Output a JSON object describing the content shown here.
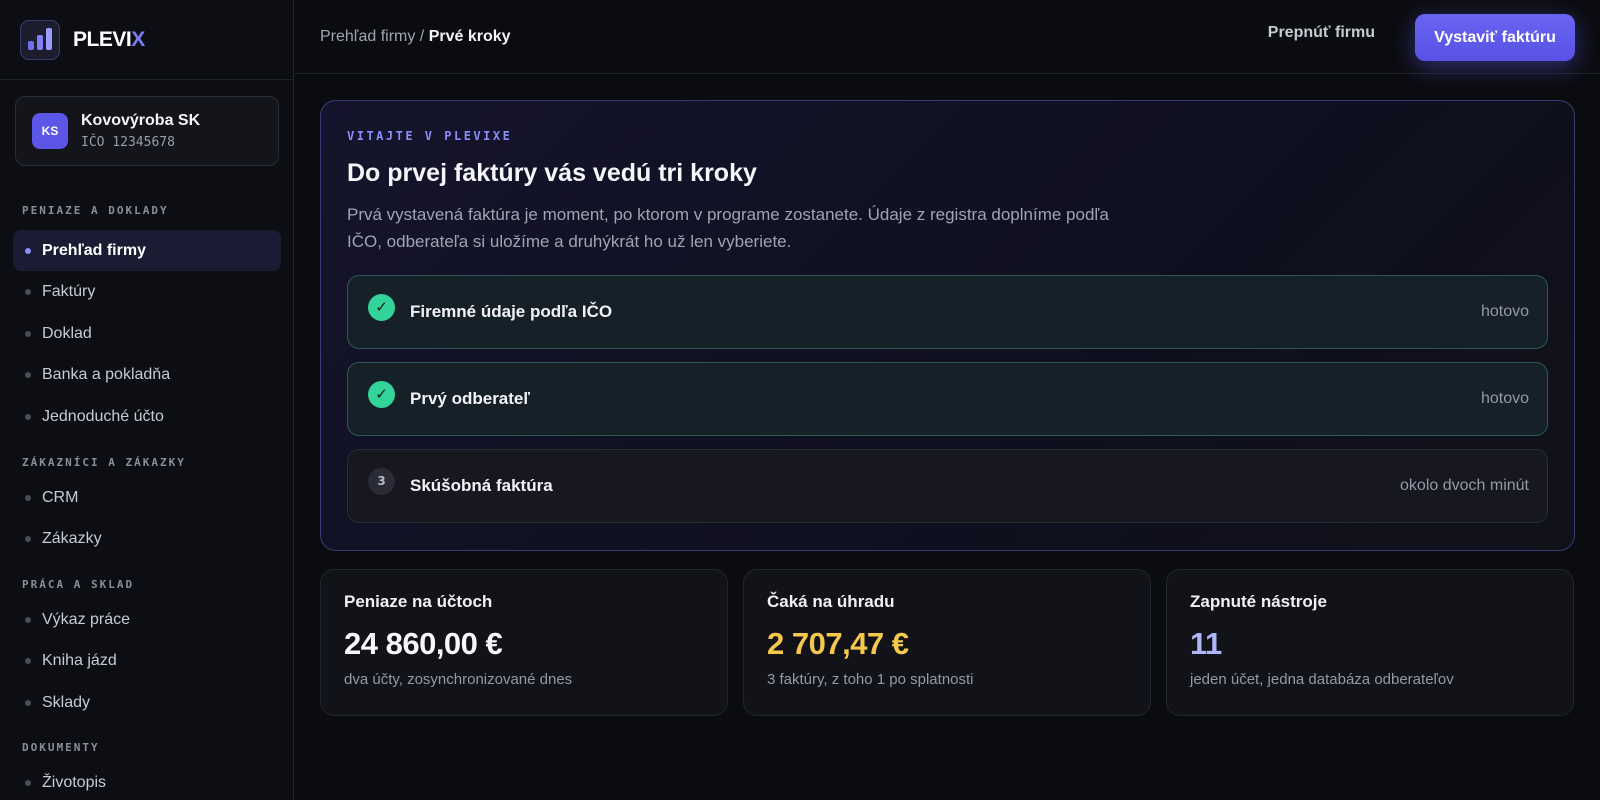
{
  "brand": {
    "name_main": "PLEVI",
    "name_accent": "X"
  },
  "company": {
    "initials": "KS",
    "name": "Kovovýroba SK",
    "ico": "IČO 12345678"
  },
  "sidebar": {
    "sections": [
      {
        "title": "PENIAZE A DOKLADY",
        "items": [
          "Prehľad firmy",
          "Faktúry",
          "Doklad",
          "Banka a pokladňa",
          "Jednoduché účto"
        ]
      },
      {
        "title": "ZÁKAZNÍCI A ZÁKAZKY",
        "items": [
          "CRM",
          "Zákazky"
        ]
      },
      {
        "title": "PRÁCA A SKLAD",
        "items": [
          "Výkaz práce",
          "Kniha jázd",
          "Sklady"
        ]
      },
      {
        "title": "DOKUMENTY",
        "items": [
          "Životopis"
        ]
      }
    ],
    "active_item": "Prehľad firmy"
  },
  "header": {
    "breadcrumb_parent": "Prehľad firmy",
    "breadcrumb_separator": " / ",
    "breadcrumb_current": "Prvé kroky",
    "switch_label": "Prepnúť firmu",
    "primary_label": "Vystaviť faktúru"
  },
  "onboarding": {
    "eyebrow": "VITAJTE V PLEVIXE",
    "title": "Do prvej faktúry vás vedú tri kroky",
    "description": "Prvá vystavená faktúra je moment, po ktorom v programe zostanete. Údaje z registra doplníme podľa IČO, odberateľa si uložíme a druhýkrát ho už len vyberiete.",
    "steps": [
      {
        "label": "Firemné údaje podľa IČO",
        "status": "hotovo",
        "done": true,
        "marker": "✓"
      },
      {
        "label": "Prvý odberateľ",
        "status": "hotovo",
        "done": true,
        "marker": "✓"
      },
      {
        "label": "Skúšobná faktúra",
        "status": "okolo dvoch minút",
        "done": false,
        "marker": "3"
      }
    ]
  },
  "stats": [
    {
      "title": "Peniaze na účtoch",
      "value": "24 860,00 €",
      "sub": "dva účty, zosynchronizované dnes"
    },
    {
      "title": "Čaká na úhradu",
      "value": "2 707,47 €",
      "sub": "3 faktúry, z toho 1 po splatnosti"
    },
    {
      "title": "Zapnuté nástroje",
      "value": "11",
      "sub": "jeden účet, jedna databáza odberateľov"
    }
  ],
  "colors": {
    "accent": "#5b55e8",
    "success": "#34d399",
    "warning": "#f6c94d",
    "background": "#0b0c10"
  }
}
